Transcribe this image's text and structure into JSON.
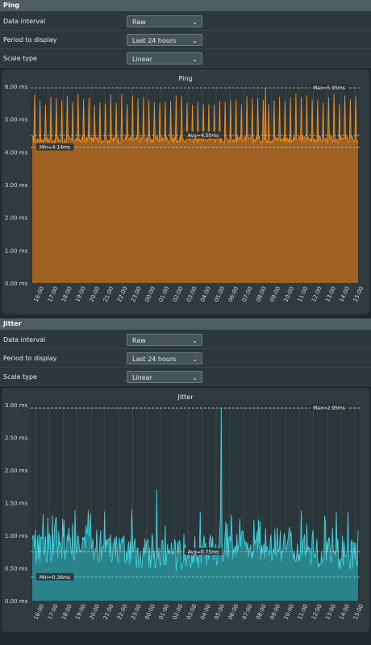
{
  "ping": {
    "section_title": "Ping",
    "controls": [
      {
        "label": "Data interval",
        "value": "Raw"
      },
      {
        "label": "Period to display",
        "value": "Last 24 hours"
      },
      {
        "label": "Scale type",
        "value": "Linear"
      }
    ]
  },
  "jitter": {
    "section_title": "Jitter",
    "controls": [
      {
        "label": "Data interval",
        "value": "Raw"
      },
      {
        "label": "Period to display",
        "value": "Last 24 hours"
      },
      {
        "label": "Scale type",
        "value": "Linear"
      }
    ]
  },
  "chart_data": [
    {
      "type": "area",
      "title": "Ping",
      "unit": "ms",
      "ylim": [
        0,
        6
      ],
      "y_ticks": [
        "0.00 ms",
        "1.00 ms",
        "2.00 ms",
        "3.00 ms",
        "4.00 ms",
        "5.00 ms",
        "6.00 ms"
      ],
      "x_ticks": [
        "16:00",
        "17:00",
        "18:00",
        "19:00",
        "20:00",
        "21:00",
        "22:00",
        "23:00",
        "00:00",
        "01:00",
        "02:00",
        "03:00",
        "04:00",
        "05:00",
        "06:00",
        "07:00",
        "08:00",
        "09:00",
        "10:00",
        "11:00",
        "12:00",
        "13:00",
        "14:00",
        "15:00"
      ],
      "baseline": 4.35,
      "spike_level": 5.6,
      "max": 5.95,
      "avg": 4.5,
      "min": 4.14,
      "max_label": "Max=5.95ms",
      "avg_label": "Avg=4.50ms",
      "min_label": "Min=4.14ms",
      "color": "#f0901e",
      "fill": "#a9641f"
    },
    {
      "type": "area",
      "title": "Jitter",
      "unit": "ms",
      "ylim": [
        0,
        3
      ],
      "y_ticks": [
        "0.00 ms",
        "0.50 ms",
        "1.00 ms",
        "1.50 ms",
        "2.00 ms",
        "2.50 ms",
        "3.00 ms"
      ],
      "x_ticks": [
        "16:00",
        "17:00",
        "18:00",
        "19:00",
        "20:00",
        "21:00",
        "22:00",
        "23:00",
        "00:00",
        "01:00",
        "02:00",
        "03:00",
        "04:00",
        "05:00",
        "06:00",
        "07:00",
        "08:00",
        "09:00",
        "10:00",
        "11:00",
        "12:00",
        "13:00",
        "14:00",
        "15:00"
      ],
      "baseline": 0.75,
      "max": 2.95,
      "avg": 0.75,
      "min": 0.36,
      "max_label": "Max=2.95ms",
      "avg_label": "Avg=0.75ms",
      "min_label": "Min=0.36ms",
      "color": "#3fd2dc",
      "fill": "#2a8a93"
    }
  ]
}
